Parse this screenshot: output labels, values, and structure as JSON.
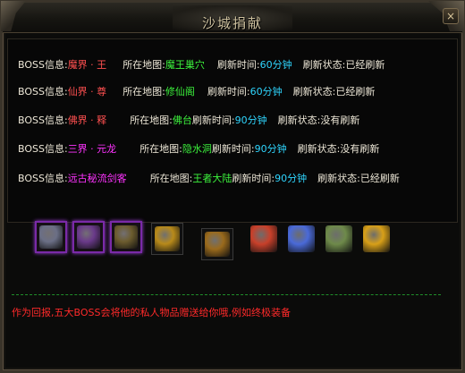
{
  "window": {
    "title": "沙城捐献",
    "close_glyph": "×"
  },
  "boss_rows": [
    {
      "label": "BOSS信息:",
      "boss": "魔界 · 王",
      "boss_color": "red",
      "map_label": "所在地图:",
      "map": "魔王巢穴",
      "time_label": "刷新时间:",
      "time": "60分钟",
      "state_label": "刷新状态:",
      "state": "已经刷新"
    },
    {
      "label": "BOSS信息:",
      "boss": "仙界 · 尊",
      "boss_color": "red",
      "map_label": "所在地图:",
      "map": "修仙阁",
      "time_label": "刷新时间:",
      "time": "60分钟",
      "state_label": "刷新状态:",
      "state": "已经刷新"
    },
    {
      "label": "BOSS信息:",
      "boss": "佛界 · 释",
      "boss_color": "red",
      "map_label": "所在地图:",
      "map": "佛台",
      "time_label": "刷新时间:",
      "time": "90分钟",
      "state_label": "刷新状态:",
      "state": "没有刷新"
    },
    {
      "label": "BOSS信息:",
      "boss": "三界 · 元龙",
      "boss_color": "magenta",
      "map_label": "所在地图:",
      "map": "隐水洞",
      "time_label": "刷新时间:",
      "time": "90分钟",
      "state_label": "刷新状态:",
      "state": "没有刷新"
    },
    {
      "label": "BOSS信息:",
      "boss": "远古秘流剑客",
      "boss_color": "magenta",
      "map_label": "所在地图:",
      "map": "王者大陆",
      "time_label": "刷新时间:",
      "time": "90分钟",
      "state_label": "刷新状态:",
      "state": "已经刷新"
    }
  ],
  "reward_items": [
    {
      "icon": "rune-stone-icon",
      "frame": "purple",
      "color": "#6b6f86"
    },
    {
      "icon": "scroll-icon",
      "frame": "purple",
      "color": "#6a3a8a"
    },
    {
      "icon": "ore-icon",
      "frame": "purple",
      "color": "#6c5c2e"
    },
    {
      "icon": "gold-bracer-icon",
      "frame": "plain",
      "color": "#b88a1a"
    },
    {
      "icon": "ruby-ring-icon",
      "frame": "plain",
      "color": "#9a6a1c"
    },
    {
      "icon": "fire-orb-icon",
      "frame": "none",
      "color": "#c8402a"
    },
    {
      "icon": "blue-crystal-icon",
      "frame": "none",
      "color": "#4a6ad8"
    },
    {
      "icon": "star-medal-icon",
      "frame": "none",
      "color": "#6e8a4a"
    },
    {
      "icon": "dragon-eye-icon",
      "frame": "none",
      "color": "#d8a018"
    }
  ],
  "footer": {
    "text": "作为回报,五大BOSS会将他的私人物品赠送给你哦,例如终极装备"
  }
}
